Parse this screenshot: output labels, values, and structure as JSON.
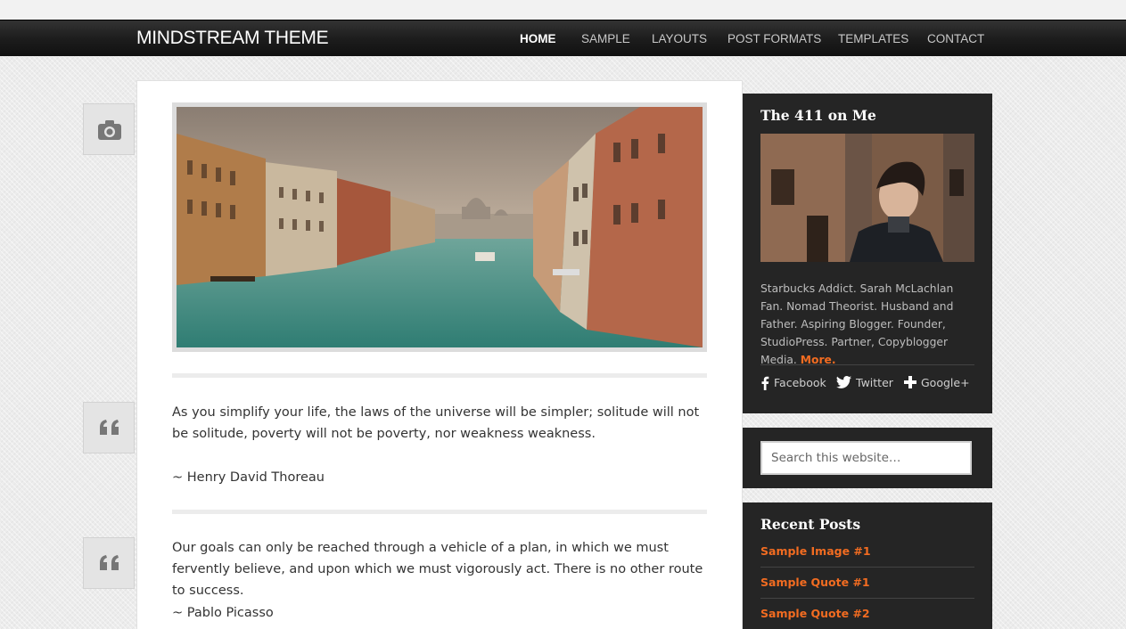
{
  "site": {
    "title": "MINDSTREAM THEME"
  },
  "nav": {
    "items": [
      {
        "label": "HOME",
        "active": true
      },
      {
        "label": "SAMPLE",
        "active": false
      },
      {
        "label": "LAYOUTS",
        "active": false
      },
      {
        "label": "POST FORMATS",
        "active": false
      },
      {
        "label": "TEMPLATES",
        "active": false
      },
      {
        "label": "CONTACT",
        "active": false
      }
    ]
  },
  "posts": [
    {
      "format": "image",
      "icon": "camera-icon"
    },
    {
      "format": "quote",
      "icon": "quote-icon",
      "text": "As you simplify your life, the laws of the universe will be simpler; solitude will not be solitude, poverty will not be poverty, nor weakness weakness.",
      "author": "~ Henry David Thoreau"
    },
    {
      "format": "quote",
      "icon": "quote-icon",
      "text": "Our goals can only be reached through a vehicle of a plan, in which we must fervently believe, and upon which we must vigorously act. There is no other route to success.",
      "author": "~ Pablo Picasso"
    }
  ],
  "sidebar": {
    "about": {
      "title": "The 411 on Me",
      "bio": "Starbucks Addict. Sarah McLachlan Fan. Nomad Theorist. Husband and Father. Aspiring Blogger. Founder, StudioPress. Partner, Copyblogger Media.",
      "more_label": "More.",
      "social": [
        {
          "label": "Facebook",
          "icon": "facebook-icon"
        },
        {
          "label": "Twitter",
          "icon": "twitter-icon"
        },
        {
          "label": "Google+",
          "icon": "google-plus-icon"
        }
      ]
    },
    "search": {
      "placeholder": "Search this website…"
    },
    "recent_posts": {
      "title": "Recent Posts",
      "items": [
        "Sample Image #1",
        "Sample Quote #1",
        "Sample Quote #2"
      ]
    }
  },
  "colors": {
    "accent": "#f26c21",
    "header_bg": "#1d1d1d",
    "widget_bg": "#252525"
  }
}
